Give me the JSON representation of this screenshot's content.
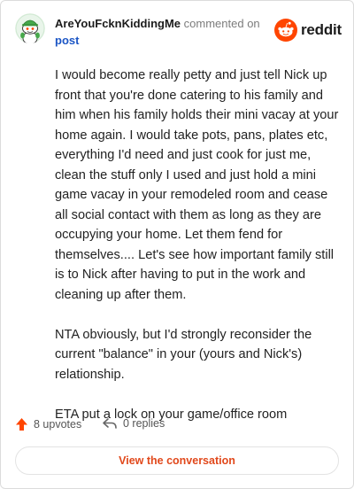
{
  "comment": {
    "username": "AreYouFcknKiddingMe",
    "action_text": "commented on",
    "post_link": "post"
  },
  "brand": {
    "wordmark": "reddit",
    "icon": "reddit-snoo-icon",
    "color": "#ff4500"
  },
  "body": {
    "paragraphs": [
      "I would become really petty and just tell Nick up front that you're done catering to his family and him when his family holds their mini vacay at your home again. I would take pots, pans, plates etc, everything I'd need and just cook for just me, clean the stuff only I used and just hold a mini game vacay in your remodeled room and cease all social contact with them as long as they are occupying your home. Let them fend for themselves.... Let's see how important family still is to Nick after having to put in the work and cleaning up after them.",
      "NTA obviously, but I'd strongly reconsider the current \"balance\" in your (yours and Nick's) relationship.",
      "ETA put a lock on your game/office room"
    ]
  },
  "actions": {
    "upvotes": "8 upvotes",
    "upvote_icon": "upvote-arrow-icon",
    "replies": "0 replies",
    "reply_icon": "reply-arrow-icon"
  },
  "cta": {
    "label": "View the conversation",
    "color": "#e1481b"
  }
}
